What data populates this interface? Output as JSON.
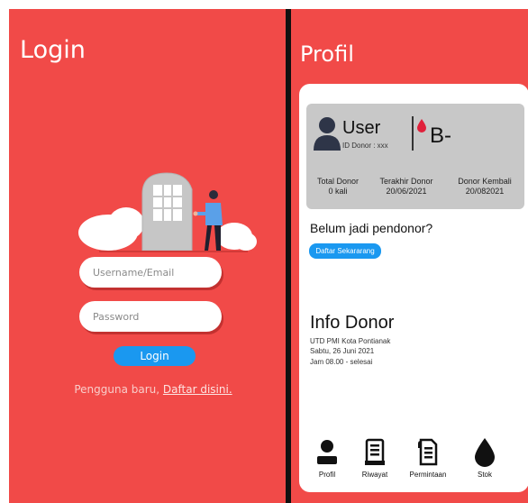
{
  "login": {
    "title": "Login",
    "username_placeholder": "Username/Email",
    "password_placeholder": "Password",
    "button_label": "Login",
    "register_prefix": "Pengguna baru, ",
    "register_link": "Daftar disini."
  },
  "profile": {
    "title": "Profil",
    "user": {
      "name": "User",
      "donor_id": "ID Donor : xxx",
      "blood_type": "B-"
    },
    "stats": [
      {
        "label": "Total Donor",
        "value": "0 kali"
      },
      {
        "label": "Terakhir Donor",
        "value": "20/06/2021"
      },
      {
        "label": "Donor  Kembali",
        "value": "20/082021"
      }
    ],
    "cta_question": "Belum jadi pendonor?",
    "cta_button": "Daftar Sekararang",
    "info": {
      "title": "Info Donor",
      "lines": [
        "UTD PMI Kota Pontianak",
        "Sabtu, 26 Juni 2021",
        "Jam 08.00 - selesai"
      ]
    },
    "nav": [
      {
        "label": "Profil",
        "icon": "person-icon"
      },
      {
        "label": "Riwayat",
        "icon": "receipt-icon"
      },
      {
        "label": "Permintaan",
        "icon": "document-icon"
      },
      {
        "label": "Stok",
        "icon": "blood-drop-icon"
      }
    ]
  },
  "colors": {
    "background": "#f14a48",
    "accent": "#1a98f0",
    "card": "#ffffff",
    "user_card": "#c8c8c8",
    "blood_drop": "#e0203a"
  }
}
